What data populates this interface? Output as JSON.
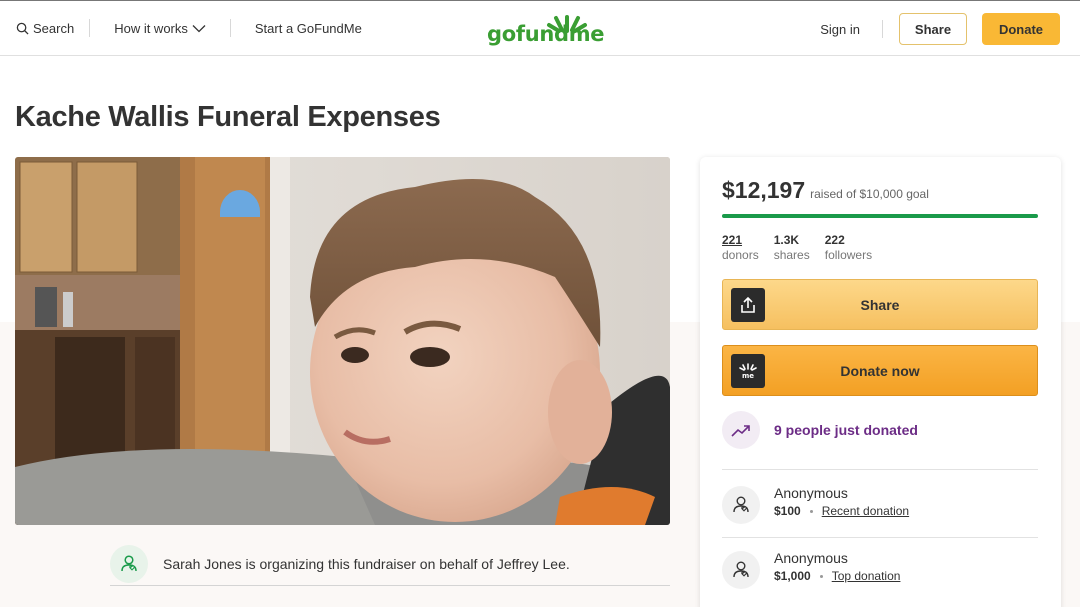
{
  "header": {
    "search_label": "Search",
    "how_it_works_label": "How it works",
    "start_label": "Start a GoFundMe",
    "logo_text": "gofundme",
    "signin_label": "Sign in",
    "share_label": "Share",
    "donate_label": "Donate"
  },
  "campaign": {
    "title": "Kache Wallis Funeral Expenses",
    "organizer_text": "Sarah Jones is organizing this fundraiser on behalf of Jeffrey Lee."
  },
  "sidebar": {
    "raised": "$12,197",
    "goal_text": "raised of $10,000 goal",
    "progress_fraction": 1.0,
    "stats": [
      {
        "value": "221",
        "label": "donors"
      },
      {
        "value": "1.3K",
        "label": "shares"
      },
      {
        "value": "222",
        "label": "followers"
      }
    ],
    "share_button": "Share",
    "donate_button": "Donate now",
    "recent_activity": "9 people just donated",
    "donations": [
      {
        "name": "Anonymous",
        "amount": "$100",
        "type": "Recent donation"
      },
      {
        "name": "Anonymous",
        "amount": "$1,000",
        "type": "Top donation"
      }
    ]
  },
  "colors": {
    "accent_green": "#1a9a4a",
    "logo_green": "#3a9e33",
    "donate_orange": "#f9b835",
    "recent_purple": "#6c2c86"
  }
}
